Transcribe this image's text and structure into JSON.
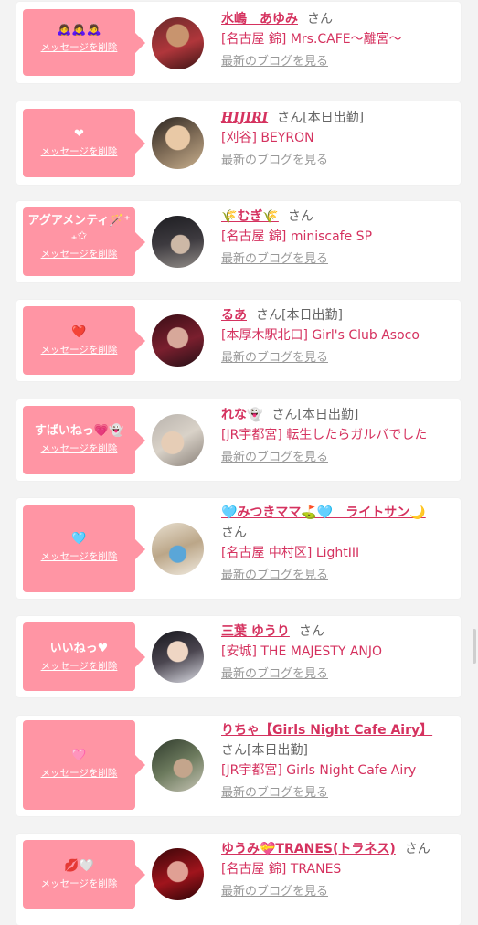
{
  "cards": [
    {
      "bubble": "🙇‍♀️🙇‍♀️🙇‍♀️",
      "delete": "メッセージを削除",
      "name": "水嶋　あゆみ",
      "san": "さん",
      "shop": "[名古屋 錦] Mrs.CAFE〜離宮〜",
      "blog": "最新のブログを見る"
    },
    {
      "bubble": "❤",
      "delete": "メッセージを削除",
      "name": "HIJIRI",
      "san": "さん[本日出勤]",
      "shop": "[刈谷] BEYRON",
      "blog": "最新のブログを見る"
    },
    {
      "bubble": "アグアメンティ🪄⁺₊✩",
      "delete": "メッセージを削除",
      "name": "🌾むぎ🌾",
      "san": "さん",
      "shop": "[名古屋 錦] miniscafe SP",
      "blog": "最新のブログを見る"
    },
    {
      "bubble": "❤️",
      "delete": "メッセージを削除",
      "name": "るあ",
      "san": "さん[本日出勤]",
      "shop": "[本厚木駅北口] Girl's Club Asoco",
      "blog": "最新のブログを見る"
    },
    {
      "bubble": "すばいねっ💗👻",
      "delete": "メッセージを削除",
      "name": "れな👻",
      "san": "さん[本日出勤]",
      "shop": "[JR宇都宮] 転生したらガルバでした",
      "blog": "最新のブログを見る"
    },
    {
      "bubble": "🩵",
      "delete": "メッセージを削除",
      "name": "🩵みつきママ⛳️🩵　ライトサン🌙",
      "san": "さん",
      "shop": "[名古屋 中村区] LightIII",
      "blog": "最新のブログを見る"
    },
    {
      "bubble": "いいねっ♥",
      "delete": "メッセージを削除",
      "name": "三葉 ゆうり",
      "san": "さん",
      "shop": "[安城] THE MAJESTY ANJO",
      "blog": "最新のブログを見る"
    },
    {
      "bubble": "🩷",
      "delete": "メッセージを削除",
      "name": "りちゃ【Girls Night Cafe Airy】",
      "san": "さん[本日出勤]",
      "shop": "[JR宇都宮] Girls Night Cafe Airy",
      "blog": "最新のブログを見る"
    },
    {
      "bubble": "💋🤍",
      "delete": "メッセージを削除",
      "name": "ゆうみ💝TRANES(トラネス)",
      "san": "さん",
      "shop": "[名古屋 錦] TRANES",
      "blog": "最新のブログを見る"
    }
  ],
  "colors": {
    "bubble": "#ff95a4",
    "accent": "#d5325f",
    "muted": "#999999"
  }
}
